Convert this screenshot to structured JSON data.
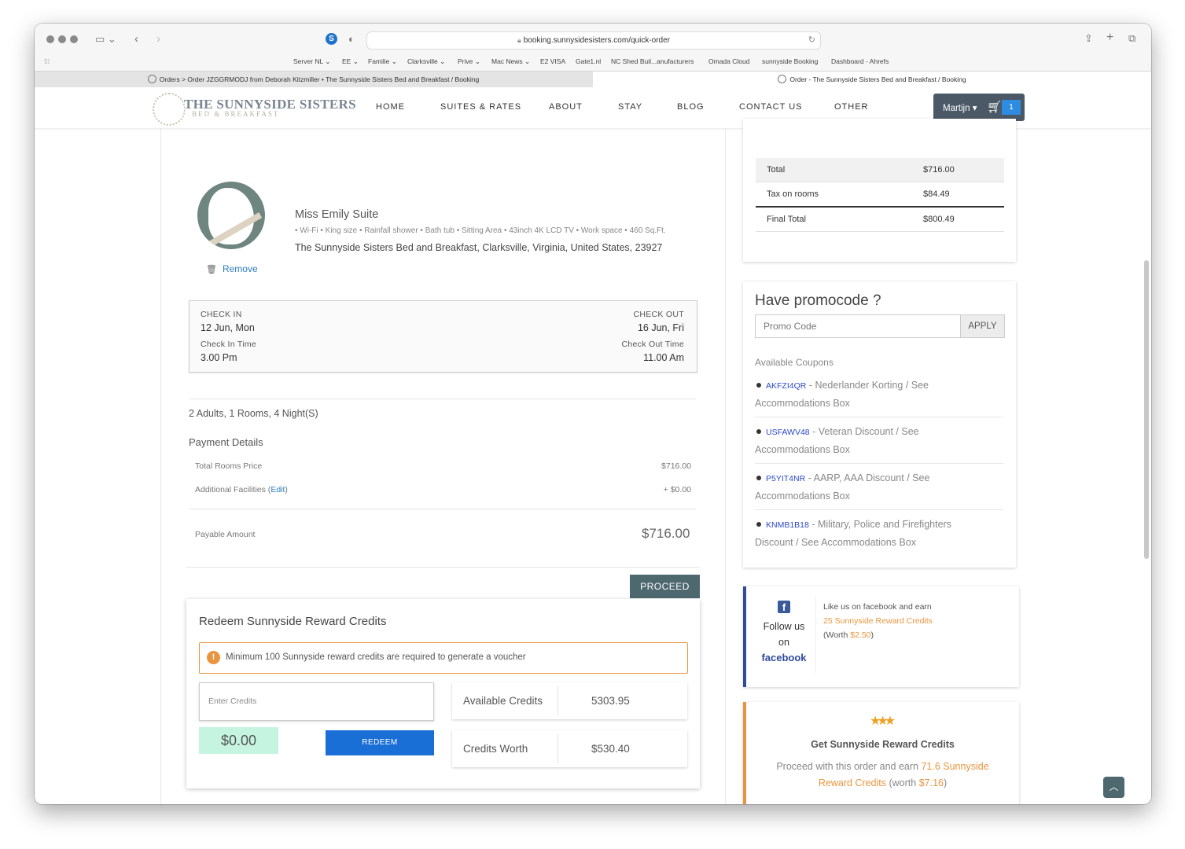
{
  "browser": {
    "url": "booking.sunnysidesisters.com/quick-order",
    "bookmarks": [
      "Server NL",
      "EE",
      "Familie",
      "Clarksville",
      "Prive",
      "Mac News",
      "E2 VISA",
      "Gate1.nl",
      "NC Shed Buil...anufacturers",
      "Omada Cloud",
      "sunnyside Booking",
      "Dashboard - Ahrefs"
    ],
    "tabs": [
      {
        "title": "Orders > Order JZGGRMODJ from Deborah Kitzmiller • The Sunnyside Sisters Bed and Breakfast / Booking"
      },
      {
        "title": "Order - The Sunnyside Sisters Bed and Breakfast / Booking"
      }
    ]
  },
  "site": {
    "logo_text": "THE SUNNYSIDE SISTERS",
    "logo_sub": "BED & BREAKFAST",
    "menu": [
      "HOME",
      "SUITES & RATES",
      "ABOUT",
      "STAY",
      "BLOG",
      "CONTACT US",
      "OTHER"
    ],
    "user": "Martijn",
    "cart_count": "1"
  },
  "suite": {
    "name": "Miss Emily Suite",
    "features": "• Wi-Fi • King size • Rainfall shower • Bath tub • Sitting Area • 43inch 4K LCD TV • Work space • 460 Sq.Ft.",
    "address": "The Sunnyside Sisters Bed and Breakfast, Clarksville, Virginia, United States, 23927",
    "remove_label": "Remove"
  },
  "dates": {
    "check_in_label": "CHECK IN",
    "check_in": "12 Jun, Mon",
    "check_out_label": "CHECK OUT",
    "check_out": "16 Jun, Fri",
    "check_in_time_label": "Check In Time",
    "check_in_time": "3.00 Pm",
    "check_out_time_label": "Check Out Time",
    "check_out_time": "11.00 Am"
  },
  "guests": "2 Adults, 1 Rooms, 4 Night(S)",
  "payment": {
    "heading": "Payment Details",
    "total_rooms_label": "Total Rooms Price",
    "total_rooms_value": "$716.00",
    "facilities_label": "Additional Facilities",
    "facilities_edit": "Edit",
    "facilities_value": "+ $0.00",
    "payable_label": "Payable Amount",
    "payable_value": "$716.00",
    "proceed_label": "PROCEED"
  },
  "redeem": {
    "title": "Redeem Sunnyside Reward Credits",
    "warning": "Minimum 100 Sunnyside reward credits are required to generate a voucher",
    "input_placeholder": "Enter Credits",
    "amount": "$0.00",
    "button": "REDEEM",
    "available_label": "Available Credits",
    "available_value": "5303.95",
    "worth_label": "Credits Worth",
    "worth_value": "$530.40"
  },
  "totals": {
    "total_label": "Total",
    "total_value": "$716.00",
    "tax_label": "Tax on rooms",
    "tax_value": "$84.49",
    "final_label": "Final Total",
    "final_value": "$800.49"
  },
  "promo": {
    "heading": "Have promocode ?",
    "placeholder": "Promo Code",
    "apply": "APPLY",
    "available_heading": "Available Coupons",
    "coupons": [
      {
        "code": "AKFZI4QR",
        "line1": " - Nederlander Korting / See",
        "line2": "Accommodations Box"
      },
      {
        "code": "USFAWV48",
        "line1": " - Veteran Discount / See",
        "line2": "Accommodations Box"
      },
      {
        "code": "P5YIT4NR",
        "line1": " - AARP, AAA Discount / See",
        "line2": "Accommodations Box"
      },
      {
        "code": "KNMB1B18",
        "line1": " - Military, Police and Firefighters",
        "line2": "Discount / See Accommodations Box"
      }
    ]
  },
  "facebook": {
    "follow_1": "Follow us",
    "follow_2": "on",
    "follow_3": "facebook",
    "text_1": "Like us on facebook and earn ",
    "credits": "25 Sunnyside Reward Credits",
    "text_2": " (Worth ",
    "worth": "$2.50",
    "text_3": ")"
  },
  "earn": {
    "heading": "Get Sunnyside Reward Credits",
    "text_1": "Proceed with this order and earn ",
    "credits": "71.6 Sunnyside Reward Credits",
    "text_2": " (worth ",
    "worth": "$7.16",
    "text_3": ")"
  },
  "colors": {
    "accent_blue": "#1a6fd6",
    "proceed_green": "#4e6870",
    "warning_orange": "#e9953f",
    "facebook_blue": "#2f4b9a"
  }
}
